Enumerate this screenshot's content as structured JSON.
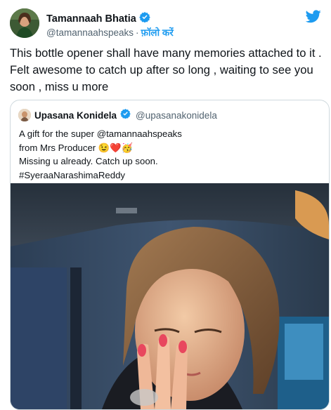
{
  "tweet": {
    "author_name": "Tamannaah Bhatia",
    "author_handle": "@tamannaahspeaks",
    "separator": "·",
    "follow_label": "फ़ॉलो करें",
    "text": "This bottle opener shall have many memories attached to it . Felt awesome to catch up after so long , waiting to see you soon , miss u more"
  },
  "quoted_tweet": {
    "author_name": "Upasana Konidela",
    "author_handle": "@upasanakonidela",
    "lines": [
      "A  gift for the super @tamannaahspeaks",
      "from Mrs Producer 😉❤️🥳",
      "Missing u already. Catch up soon.",
      "#SyeraaNarashimaReddy"
    ]
  },
  "colors": {
    "brand_blue": "#1d9bf0",
    "text_primary": "#0f1419",
    "text_secondary": "#536471",
    "border": "#cfd9de"
  },
  "icons": [
    "verified-badge-icon",
    "twitter-bird-icon"
  ]
}
